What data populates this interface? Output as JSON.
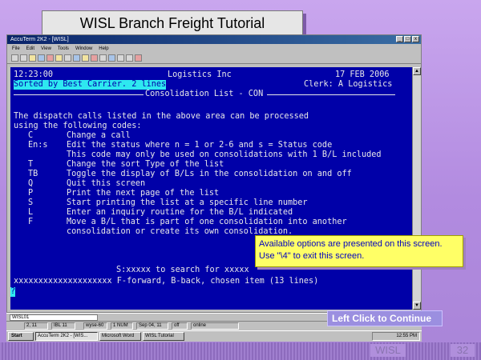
{
  "slide": {
    "title": "WISL Branch Freight Tutorial",
    "footer_brand": "WISL",
    "page_number": "32",
    "continue_label": "Left Click to Continue"
  },
  "window": {
    "title": "AccuTerm 2K2 - [WISL]",
    "menu": [
      "File",
      "Edit",
      "View",
      "Tools",
      "Window",
      "Help"
    ],
    "minimize_label": "_",
    "maximize_label": "□",
    "close_label": "x"
  },
  "terminal": {
    "time": "12:23:00",
    "company": "Logistics Inc",
    "date": "17 FEB 2006",
    "sort_status": "Sorted by Best Carrier. 2 lines",
    "clerk": "Clerk: A Logistics",
    "section_title": "Consolidation List - CON",
    "intro_line1": "The dispatch calls listed in the above area can be processed",
    "intro_line2": "using the following codes:",
    "codes": [
      {
        "code": "C",
        "desc": "Change a call"
      },
      {
        "code": "En:s",
        "desc": "Edit the status where n = 1 or 2-6 and s = Status code"
      },
      {
        "code": "",
        "desc": "This code may only be used on consolidations with 1 B/L included"
      },
      {
        "code": "T",
        "desc": "Change the sort Type of the list"
      },
      {
        "code": "TB",
        "desc": "Toggle the display of B/Ls in the consolidation on and off"
      },
      {
        "code": "Q",
        "desc": "Quit this screen"
      },
      {
        "code": "P",
        "desc": "Print the next page of the list"
      },
      {
        "code": "S",
        "desc": "Start printing the list at a specific line number"
      },
      {
        "code": "L",
        "desc": "Enter an inquiry routine for the B/L indicated"
      },
      {
        "code": "F",
        "desc": "Move a B/L that is part of one consolidation into another"
      },
      {
        "code": "",
        "desc": "consolidation or create its own consolidation."
      }
    ],
    "search_hint": "S:xxxxx to search for xxxxx",
    "nav_line": "xxxxxxxxxxxxxxxxxxxx F-forward, B-back, chosen item (13 lines)",
    "prompt": "?"
  },
  "callout": {
    "line1": "Available options are presented on this screen.",
    "line2": "Use \"\\4\" to exit this screen."
  },
  "status": {
    "input_value": "WISL01",
    "cells": [
      "2, 11",
      "IBL 11",
      "wyse-60",
      "1 NUM",
      "Sep 04, 11",
      "off",
      "online"
    ]
  },
  "taskbar": {
    "start_label": "Start",
    "tasks": [
      "AccuTerm 2K2 - [WIS...",
      "Microsoft Word",
      "WISL Tutorial"
    ],
    "clock": "12:55 PM"
  },
  "colors": {
    "terminal_bg": "#0000a8",
    "terminal_fg": "#e8e8e8",
    "highlight": "#2ee8f0",
    "callout_bg": "#ffff66",
    "callout_text": "#0000c0"
  }
}
